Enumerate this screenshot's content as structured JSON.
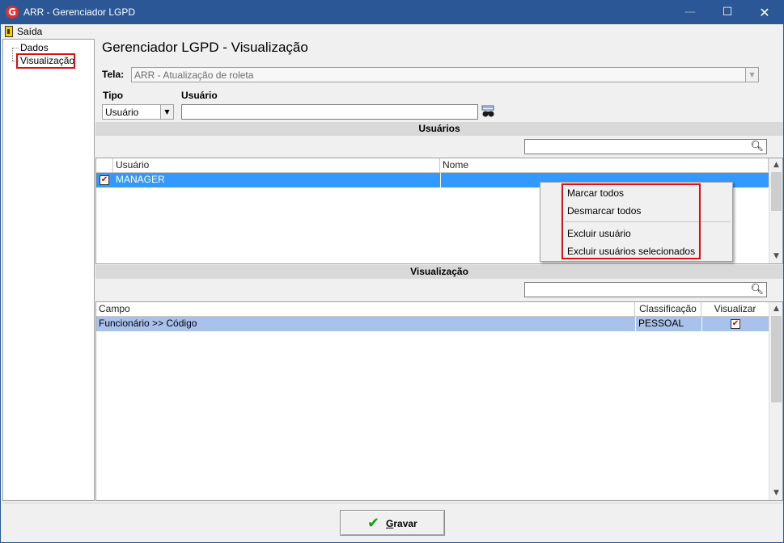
{
  "window": {
    "title": "ARR - Gerenciador LGPD",
    "app_icon_letter": "G",
    "controls": {
      "minimize": "—",
      "maximize": "☐",
      "close": "✕"
    }
  },
  "menu": {
    "exit_label": "Saída"
  },
  "tree": {
    "items": [
      {
        "label": "Dados"
      },
      {
        "label": "Visualização",
        "selected": true
      }
    ]
  },
  "page": {
    "title": "Gerenciador LGPD - Visualização",
    "tela_label": "Tela:",
    "tela_value": "ARR - Atualização de roleta",
    "tipo_label": "Tipo",
    "tipo_value": "Usuário",
    "usuario_label": "Usuário",
    "usuario_value": "",
    "binoculars_icon": "binoculars-icon"
  },
  "users_section": {
    "header": "Usuários",
    "search_value": "",
    "columns": [
      "Usuário",
      "Nome"
    ],
    "rows": [
      {
        "checked": true,
        "usuario": "MANAGER",
        "nome": ""
      }
    ]
  },
  "context_menu": {
    "items": [
      "Marcar todos",
      "Desmarcar todos",
      "Excluir usuário",
      "Excluir usuários selecionados"
    ]
  },
  "view_section": {
    "header": "Visualização",
    "search_value": "",
    "columns": [
      "Campo",
      "Classificação",
      "Visualizar"
    ],
    "rows": [
      {
        "campo": "Funcionário >> Código",
        "classificacao": "PESSOAL",
        "visualizar": true
      }
    ]
  },
  "footer": {
    "save_label": "Gravar",
    "save_underline": "G",
    "save_rest": "ravar"
  },
  "colors": {
    "titlebar": "#2b5797",
    "selected_row": "#3399ff",
    "view_row": "#a9c2ec",
    "highlight": "#e01010",
    "check": "#1a9b1a"
  }
}
